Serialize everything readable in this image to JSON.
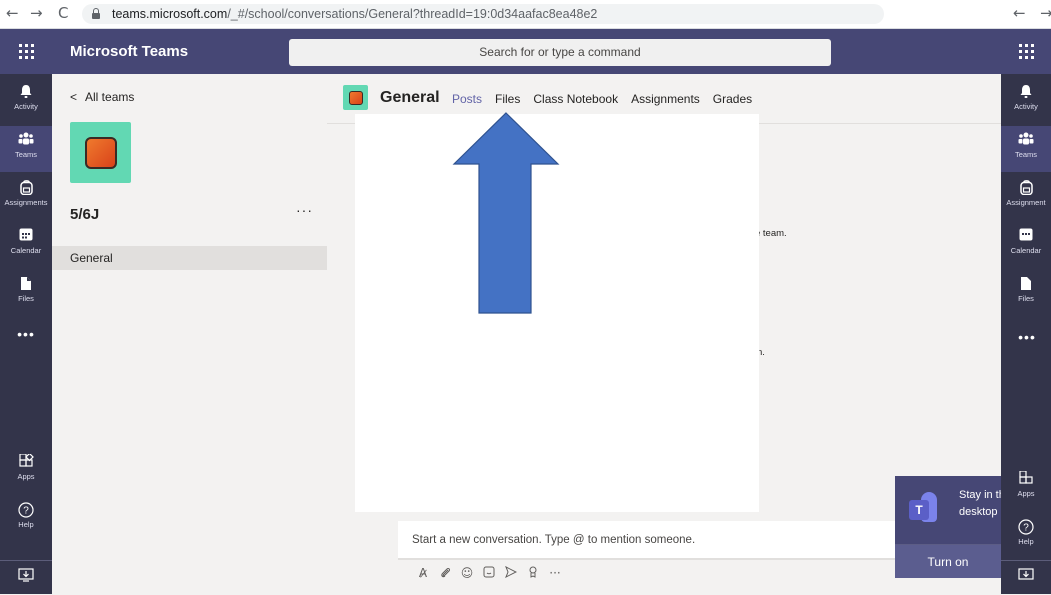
{
  "browser": {
    "back": "←",
    "forward": "→",
    "reload": "C",
    "url_host": "teams.microsoft.com",
    "url_path": "/_#/school/conversations/General?threadId=19:0d34aafac8ea48e2",
    "right_back": "←",
    "right_forward": "→"
  },
  "app": {
    "brand": "Microsoft Teams",
    "search_placeholder": "Search for or type a command"
  },
  "rail": {
    "items": [
      {
        "label": "Activity",
        "icon": "bell-icon",
        "glyph": "🔔"
      },
      {
        "label": "Teams",
        "icon": "teams-icon",
        "glyph": "👥"
      },
      {
        "label": "Assignments",
        "icon": "assignments-icon",
        "glyph": "🎒"
      },
      {
        "label": "Calendar",
        "icon": "calendar-icon",
        "glyph": "📅"
      },
      {
        "label": "Files",
        "icon": "files-icon",
        "glyph": "📄"
      }
    ],
    "more": "•••",
    "apps": "Apps",
    "help": "Help"
  },
  "rail_right": {
    "items": [
      "Activity",
      "Teams",
      "Assignment",
      "Calendar",
      "Files"
    ],
    "more": "•••",
    "apps": "Apps",
    "help": "Help"
  },
  "team_panel": {
    "back_label": "All teams",
    "team_name": "5/6J",
    "more": "···",
    "channel": "General"
  },
  "channel_header": {
    "title": "General",
    "tabs": [
      "Posts",
      "Files",
      "Class Notebook",
      "Assignments",
      "Grades"
    ],
    "active_tab": "Posts"
  },
  "feed": {
    "fragment_1": "e team.",
    "fragment_2": "n."
  },
  "compose": {
    "placeholder": "Start a new conversation. Type @ to mention someone.",
    "more": "···"
  },
  "toast": {
    "line1": "Stay in th",
    "line2": "desktop",
    "button": "Turn on"
  },
  "colors": {
    "header": "#464775",
    "rail": "#33344a",
    "accent": "#6264a7",
    "annotation_arrow": "#4472c4"
  }
}
